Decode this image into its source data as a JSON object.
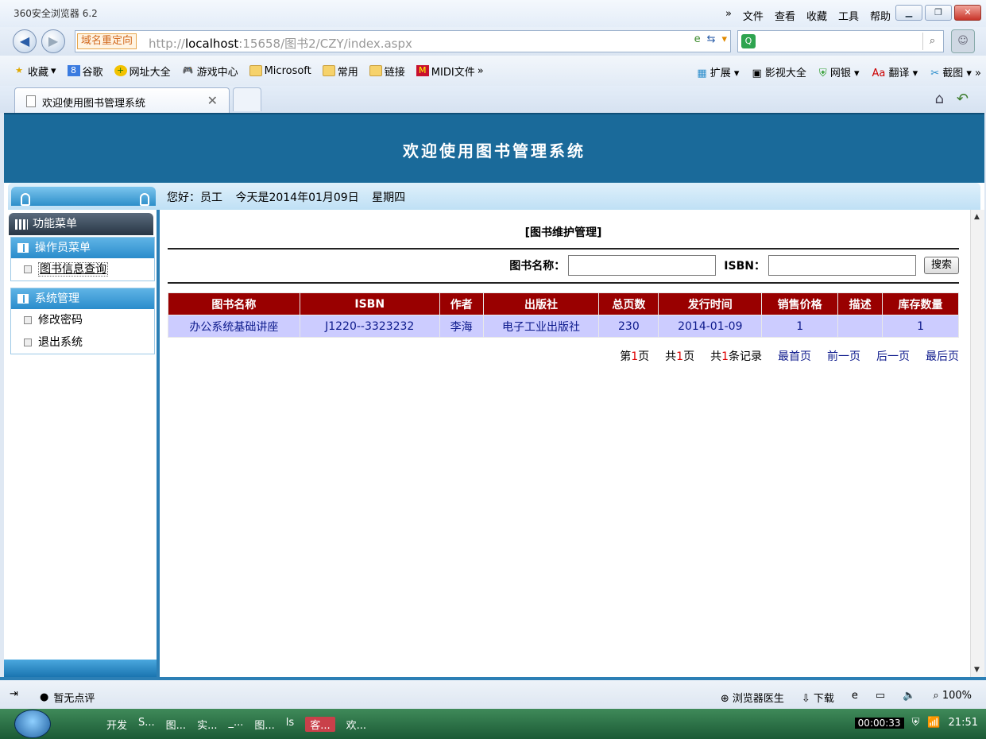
{
  "browser": {
    "app_title": "360安全浏览器 6.2",
    "menu": [
      "»",
      "文件",
      "查看",
      "收藏",
      "工具",
      "帮助"
    ],
    "redirect_label": "域名重定向",
    "url_prefix": "http://",
    "url_host": "localhost",
    "url_rest": ":15658/图书2/CZY/index.aspx",
    "favorites": [
      "收藏",
      "谷歌",
      "网址大全",
      "游戏中心",
      "Microsoft",
      "常用",
      "链接",
      "MIDI文件"
    ],
    "favorites_right": [
      "扩展",
      "影视大全",
      "网银",
      "翻译",
      "截图"
    ],
    "tab_title": "欢迎使用图书管理系统"
  },
  "page": {
    "banner_title": "欢迎使用图书管理系统",
    "greeting": "您好：员工",
    "date_text": "今天是2014年01月09日",
    "weekday": "星期四"
  },
  "sidebar": {
    "header": "功能菜单",
    "groups": [
      {
        "title": "操作员菜单",
        "items": [
          "图书信息查询"
        ]
      },
      {
        "title": "系统管理",
        "items": [
          "修改密码",
          "退出系统"
        ]
      }
    ]
  },
  "main": {
    "title": "[图书维护管理]",
    "search": {
      "name_label": "图书名称：",
      "isbn_label": "ISBN：",
      "button": "搜索"
    },
    "table": {
      "headers": [
        "图书名称",
        "ISBN",
        "作者",
        "出版社",
        "总页数",
        "发行时间",
        "销售价格",
        "描述",
        "库存数量"
      ],
      "rows": [
        [
          "办公系统基础讲座",
          "J1220--3323232",
          "李海",
          "电子工业出版社",
          "230",
          "2014-01-09",
          "1",
          "",
          "1"
        ]
      ]
    },
    "pager": {
      "page_pre": "第",
      "page_num": "1",
      "page_suf": "页",
      "total_pre": "共",
      "total_num": "1",
      "total_suf": "页",
      "rec_pre": "共",
      "rec_num": "1",
      "rec_suf": "条记录",
      "first": "最首页",
      "prev": "前一页",
      "next": "后一页",
      "last": "最后页"
    }
  },
  "statusbar": {
    "review": "暂无点评",
    "doctor": "浏览器医生",
    "download": "下载",
    "zoom": "100%"
  },
  "taskbar": {
    "items": [
      "开发",
      "S...",
      "图...",
      "实...",
      "_...",
      "图...",
      "ls",
      "客...",
      "欢..."
    ],
    "recorder": "00:00:33",
    "clock": "21:51"
  }
}
